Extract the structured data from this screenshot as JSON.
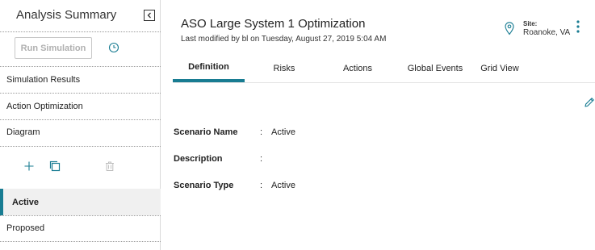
{
  "sidebar": {
    "title": "Analysis Summary",
    "run_button_label": "Run Simulation",
    "items": [
      {
        "label": "Simulation Results"
      },
      {
        "label": "Action Optimization"
      },
      {
        "label": "Diagram"
      }
    ],
    "scenarios": [
      {
        "label": "Active",
        "selected": true
      },
      {
        "label": "Proposed",
        "selected": false
      }
    ],
    "icons": {
      "collapse": "collapse-left-icon",
      "history": "clock-icon",
      "add": "plus-icon",
      "copy": "copy-icon",
      "delete": "trash-icon"
    }
  },
  "header": {
    "title": "ASO Large System 1 Optimization",
    "subtitle": "Last modified by bl on Tuesday, August 27, 2019 5:04 AM",
    "site_label": "Site:",
    "site_value": "Roanoke, VA",
    "icons": {
      "site": "location-pin-icon",
      "menu": "kebab-menu-icon",
      "edit": "pencil-icon"
    }
  },
  "tabs": [
    {
      "label": "Definition",
      "active": true
    },
    {
      "label": "Risks",
      "active": false
    },
    {
      "label": "Actions",
      "active": false
    },
    {
      "label": "Global Events",
      "active": false
    },
    {
      "label": "Grid View",
      "active": false
    }
  ],
  "details": [
    {
      "label": "Scenario Name",
      "value": "Active"
    },
    {
      "label": "Description",
      "value": ""
    },
    {
      "label": "Scenario Type",
      "value": "Active"
    }
  ],
  "colors": {
    "accent": "#187c92",
    "disabled_text": "#b0b0b0"
  }
}
